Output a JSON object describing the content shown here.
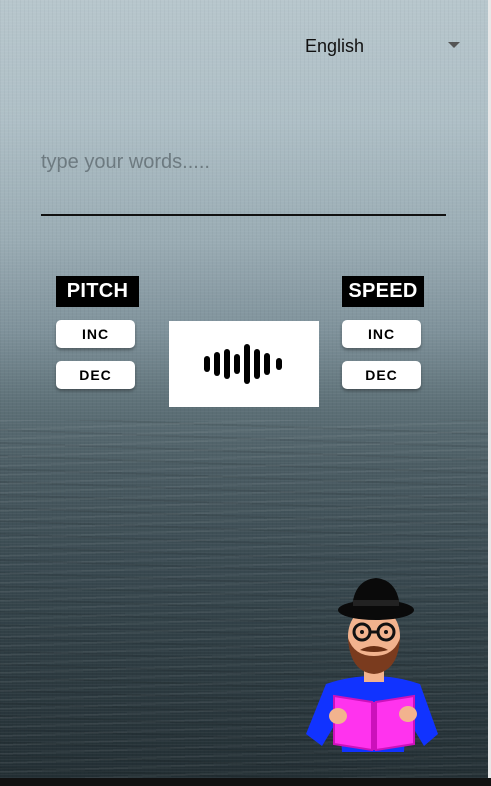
{
  "language_select": {
    "value": "English"
  },
  "text_input": {
    "placeholder": "type your words.....",
    "value": ""
  },
  "pitch": {
    "label": "PITCH",
    "inc_label": "INC",
    "dec_label": "DEC"
  },
  "speed": {
    "label": "SPEED",
    "inc_label": "INC",
    "dec_label": "DEC"
  },
  "icons": {
    "speak": "sound-wave-icon",
    "dropdown": "chevron-down-icon",
    "mascot": "reading-man-illustration"
  },
  "colors": {
    "tag_background": "#000000",
    "button_background": "#ffffff",
    "mascot_book": "#ff33ee",
    "mascot_shirt": "#1133ff"
  }
}
